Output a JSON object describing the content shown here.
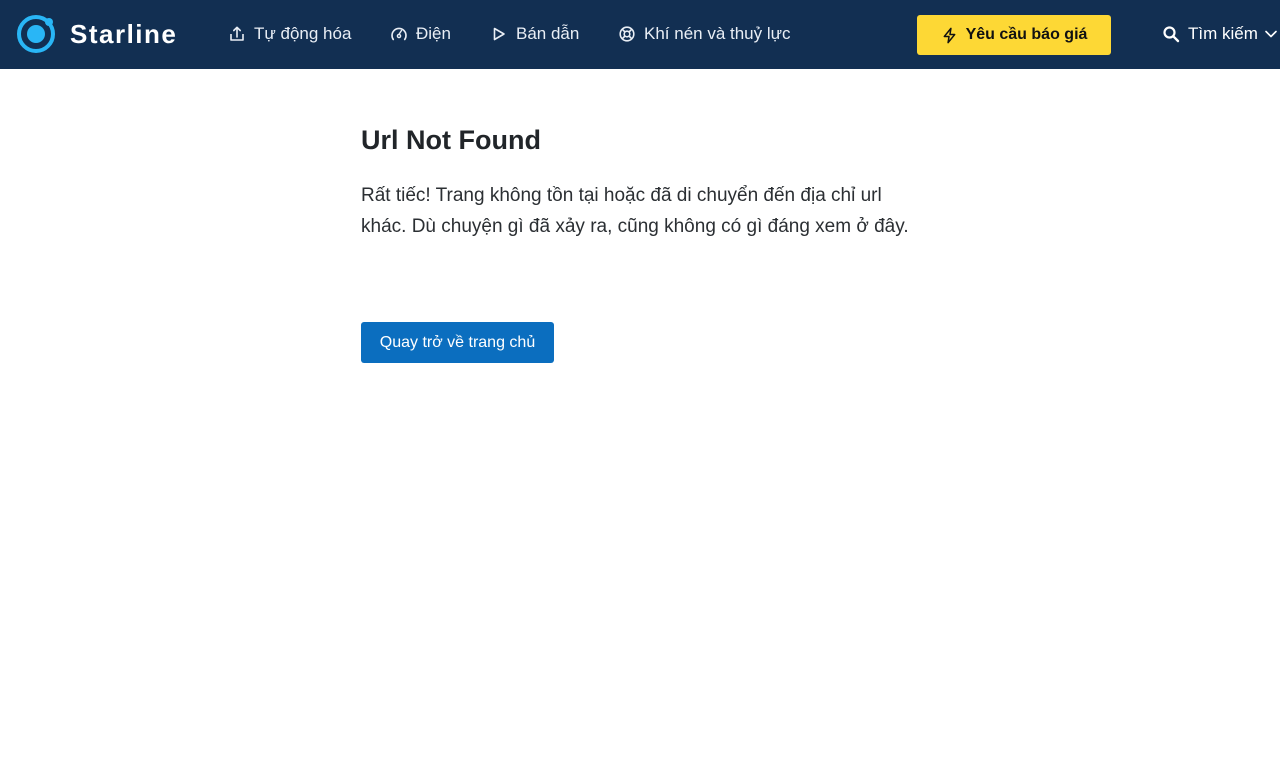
{
  "brand": {
    "name": "Starline",
    "logo_icon": "ring-dot-logo-icon",
    "logo_color": "#29b6f6"
  },
  "nav": {
    "items": [
      {
        "label": "Tự động hóa",
        "icon": "upload-icon"
      },
      {
        "label": "Điện",
        "icon": "gauge-icon"
      },
      {
        "label": "Bán dẫn",
        "icon": "play-triangle-icon"
      },
      {
        "label": "Khí nén và thuỷ lực",
        "icon": "life-buoy-icon"
      }
    ],
    "cta_label": "Yêu cầu báo giá",
    "cta_icon": "lightning-icon",
    "search_label": "Tìm kiếm",
    "search_icon": "search-icon"
  },
  "main": {
    "title": "Url Not Found",
    "message": "Rất tiếc! Trang không tồn tại hoặc đã di chuyển đến địa chỉ url khác. Dù chuyện gì đã xảy ra, cũng không có gì đáng xem ở đây.",
    "home_button_label": "Quay trở về trang chủ"
  },
  "colors": {
    "navbar_bg": "#122f52",
    "cta_bg": "#fdd835",
    "primary_button_bg": "#0b6ebf"
  }
}
